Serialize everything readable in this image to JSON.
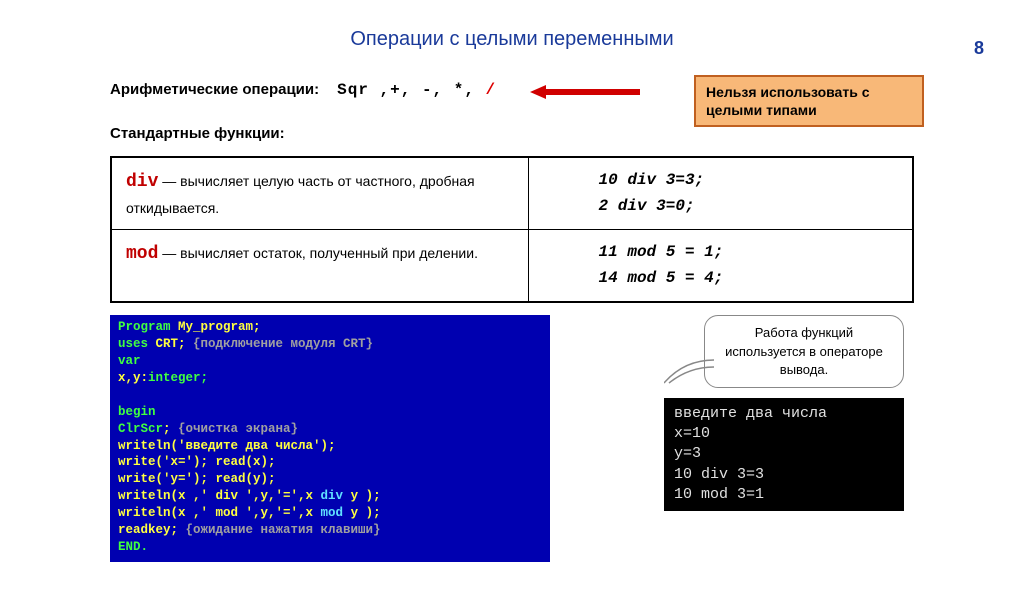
{
  "pageNumber": "8",
  "title": "Операции с целыми переменными",
  "arith": {
    "label": "Арифметические операции:",
    "ops_plain": "Sqr ,+, -,  *, ",
    "ops_slash": "/"
  },
  "callout": "Нельзя использовать с целыми типами",
  "stdLabel": "Стандартные функции:",
  "table": {
    "divKw": "div",
    "divDesc": " — вычисляет целую часть от частного, дробная откидывается.",
    "divEx1": "10  div   3=3;",
    "divEx2": "2   div   3=0;",
    "modKw": "mod",
    "modDesc": " — вычисляет остаток, полученный при делении.",
    "modEx1": "11   mod  5 = 1;",
    "modEx2": "14   mod  5 = 4;"
  },
  "code": {
    "l1a": "Program ",
    "l1b": "My_program;",
    "l2a": "uses ",
    "l2b": "CRT;",
    "l2c": "   {подключение модуля CRT}",
    "l3": "var",
    "l4a": "   x,y:",
    "l4b": "integer;",
    "l5": "begin",
    "l6a": "ClrScr",
    "l6b": ";  ",
    "l6c": "{очистка экрана}",
    "l7": "writeln('введите два числа');",
    "l8": "write('x='); read(x);",
    "l9": "write('y='); read(y);",
    "l10a": "writeln(x ,' div ',y,'=',x ",
    "l10b": "div",
    "l10c": " y );",
    "l11a": "writeln(x ,' mod ',y,'=',x ",
    "l11b": "mod",
    "l11c": " y );",
    "l12a": "readkey;",
    "l12b": "   {ожидание нажатия клавиши}",
    "l13": "END."
  },
  "bubble": "Работа функций используется в операторе вывода.",
  "console": {
    "l1": "введите два числа",
    "l2": "x=10",
    "l3": "y=3",
    "l4": "10 div 3=3",
    "l5": "10 mod 3=1"
  }
}
